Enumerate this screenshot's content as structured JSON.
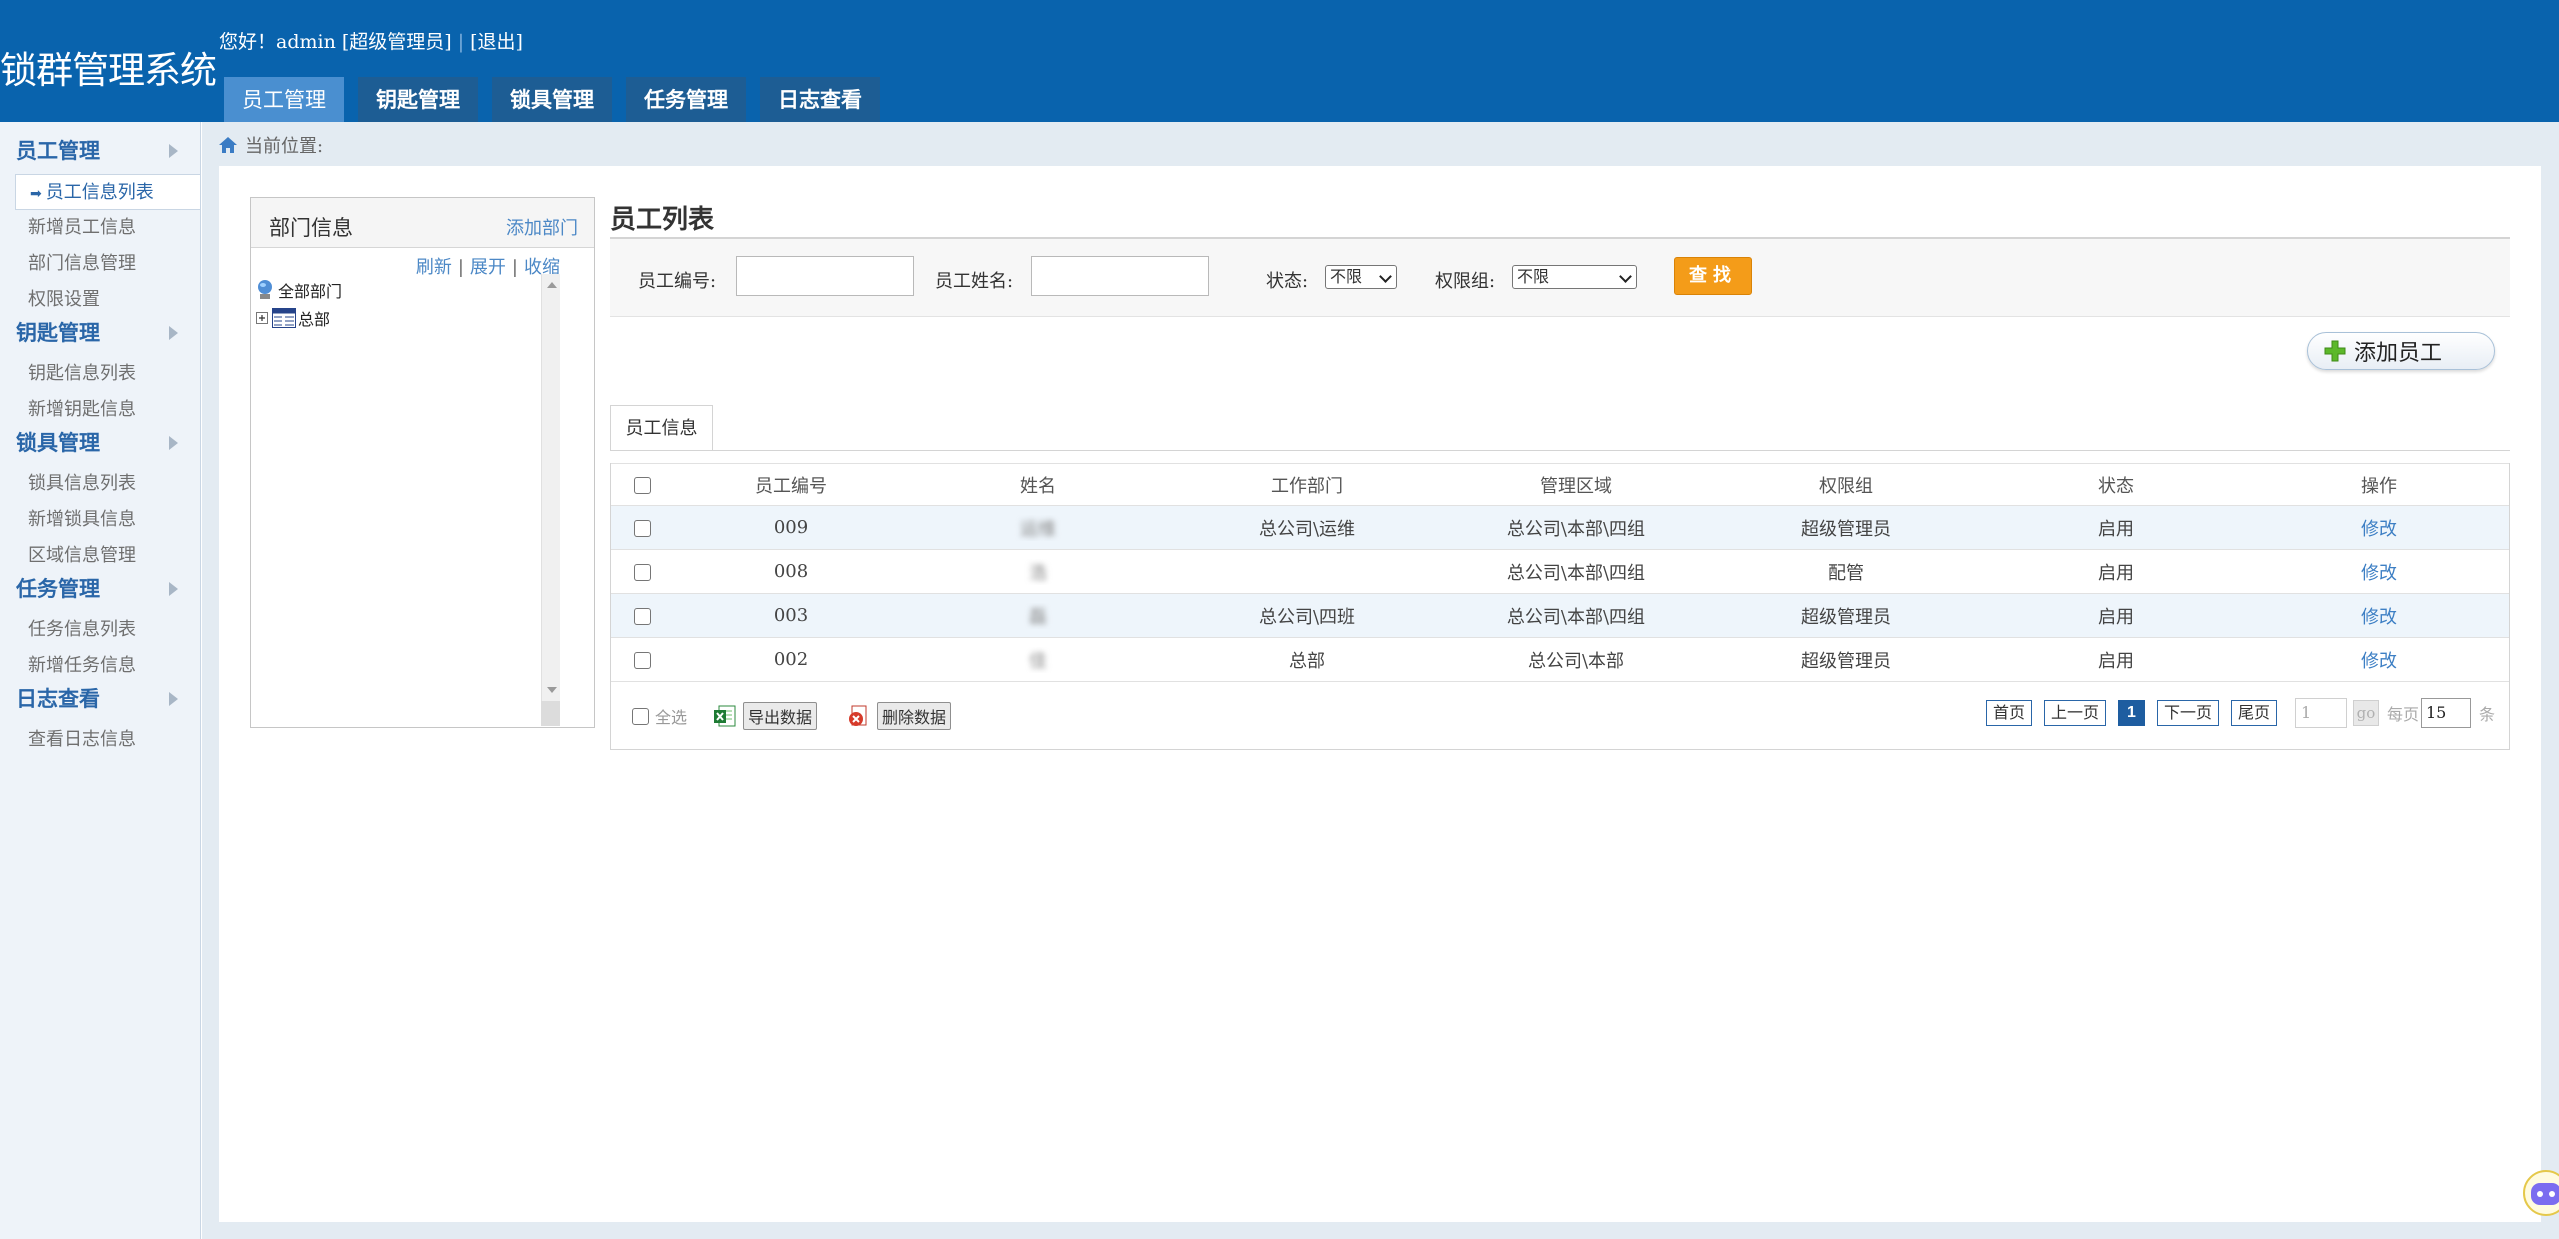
{
  "app": {
    "title": "锁群管理系统",
    "greeting": "您好！admin [超级管理员]",
    "logout": "[退出]"
  },
  "topnav": {
    "tabs": [
      {
        "label": "员工管理",
        "active": true
      },
      {
        "label": "钥匙管理",
        "active": false
      },
      {
        "label": "锁具管理",
        "active": false
      },
      {
        "label": "任务管理",
        "active": false
      },
      {
        "label": "日志查看",
        "active": false
      }
    ]
  },
  "sidebar": {
    "sections": [
      {
        "label": "员工管理",
        "items": [
          "员工信息列表",
          "新增员工信息",
          "部门信息管理",
          "权限设置"
        ]
      },
      {
        "label": "钥匙管理",
        "items": [
          "钥匙信息列表",
          "新增钥匙信息"
        ]
      },
      {
        "label": "锁具管理",
        "items": [
          "锁具信息列表",
          "新增锁具信息",
          "区域信息管理"
        ]
      },
      {
        "label": "任务管理",
        "items": [
          "任务信息列表",
          "新增任务信息"
        ]
      },
      {
        "label": "日志查看",
        "items": [
          "查看日志信息"
        ]
      }
    ],
    "active_item": "员工信息列表"
  },
  "breadcrumb": {
    "label": "当前位置:"
  },
  "dept_panel": {
    "title": "部门信息",
    "add_label": "添加部门",
    "refresh": "刷新",
    "expand": "展开",
    "collapse": "收缩",
    "tree": {
      "root": "全部部门",
      "child": "总部"
    }
  },
  "list": {
    "title": "员工列表",
    "search": {
      "id_label": "员工编号:",
      "id_value": "",
      "name_label": "员工姓名:",
      "name_value": "",
      "status_label": "状态:",
      "status_value": "不限",
      "perm_label": "权限组:",
      "perm_value": "不限",
      "search_button": "查找"
    },
    "add_button": "添加员工",
    "tab_label": "员工信息",
    "columns": [
      "员工编号",
      "姓名",
      "工作部门",
      "管理区域",
      "权限组",
      "状态",
      "操作"
    ],
    "rows": [
      {
        "id": "009",
        "name": "运维",
        "dept": "总公司\\运维",
        "area": "总公司\\本部\\四组",
        "group": "超级管理员",
        "status": "启用",
        "action": "修改"
      },
      {
        "id": "008",
        "name": "浩",
        "dept": "",
        "area": "总公司\\本部\\四组",
        "group": "配管",
        "status": "启用",
        "action": "修改"
      },
      {
        "id": "003",
        "name": "磊",
        "dept": "总公司\\四班",
        "area": "总公司\\本部\\四组",
        "group": "超级管理员",
        "status": "启用",
        "action": "修改"
      },
      {
        "id": "002",
        "name": "佳",
        "dept": "总部",
        "area": "总公司\\本部",
        "group": "超级管理员",
        "status": "启用",
        "action": "修改"
      }
    ],
    "footer": {
      "select_all": "全选",
      "export": "导出数据",
      "delete": "删除数据"
    },
    "pager": {
      "first": "首页",
      "prev": "上一页",
      "current": "1",
      "next": "下一页",
      "last": "尾页",
      "goto_value": "1",
      "go": "go",
      "per_page_label": "每页",
      "per_page_value": "15",
      "unit": "条"
    }
  },
  "colors": {
    "header_bg": "#0963ad",
    "nav_tab": "#1d5d94",
    "nav_tab_active": "#4a8fd0",
    "link": "#3d7fc4",
    "search_button": "#f49c19"
  }
}
